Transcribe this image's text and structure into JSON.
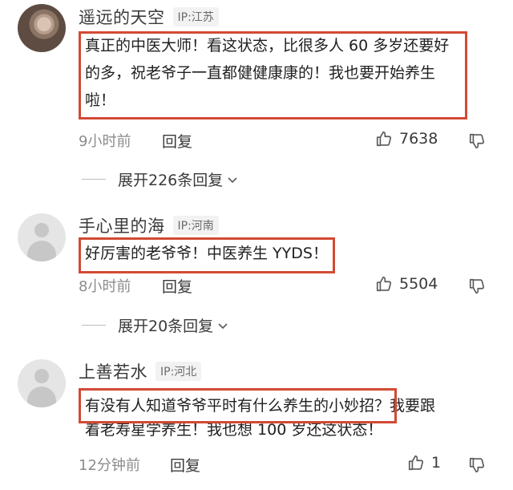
{
  "comments": [
    {
      "username": "遥远的天空",
      "ip": "IP:江苏",
      "lines": [
        "真正的中医大师！看这状态，比很多人 60 多岁还要好",
        "的多，祝老爷子一直都健健康康的！我也要开始养生",
        "啦！"
      ],
      "time": "9小时前",
      "reply_label": "回复",
      "likes": "7638",
      "expand_label": "展开226条回复",
      "avatar": "user-photo"
    },
    {
      "username": "手心里的海",
      "ip": "IP:河南",
      "lines": [
        "好厉害的老爷爷！中医养生 YYDS！"
      ],
      "time": "8小时前",
      "reply_label": "回复",
      "likes": "5504",
      "expand_label": "展开20条回复",
      "avatar": "default-avatar"
    },
    {
      "username": "上善若水",
      "ip": "IP:河北",
      "lines": [
        "有没有人知道爷爷平时有什么养生的小妙招？我要跟",
        "着老寿星学养生！我也想 100 岁还这状态！"
      ],
      "time": "12分钟前",
      "reply_label": "回复",
      "likes": "1",
      "avatar": "default-avatar"
    }
  ],
  "icons": {
    "like": "thumbs-up-icon",
    "dislike": "thumbs-down-icon",
    "expand": "chevron-down-icon"
  },
  "colors": {
    "highlight": "#d24a35",
    "muted": "#8c8c8c",
    "text": "#1f1f1f"
  }
}
